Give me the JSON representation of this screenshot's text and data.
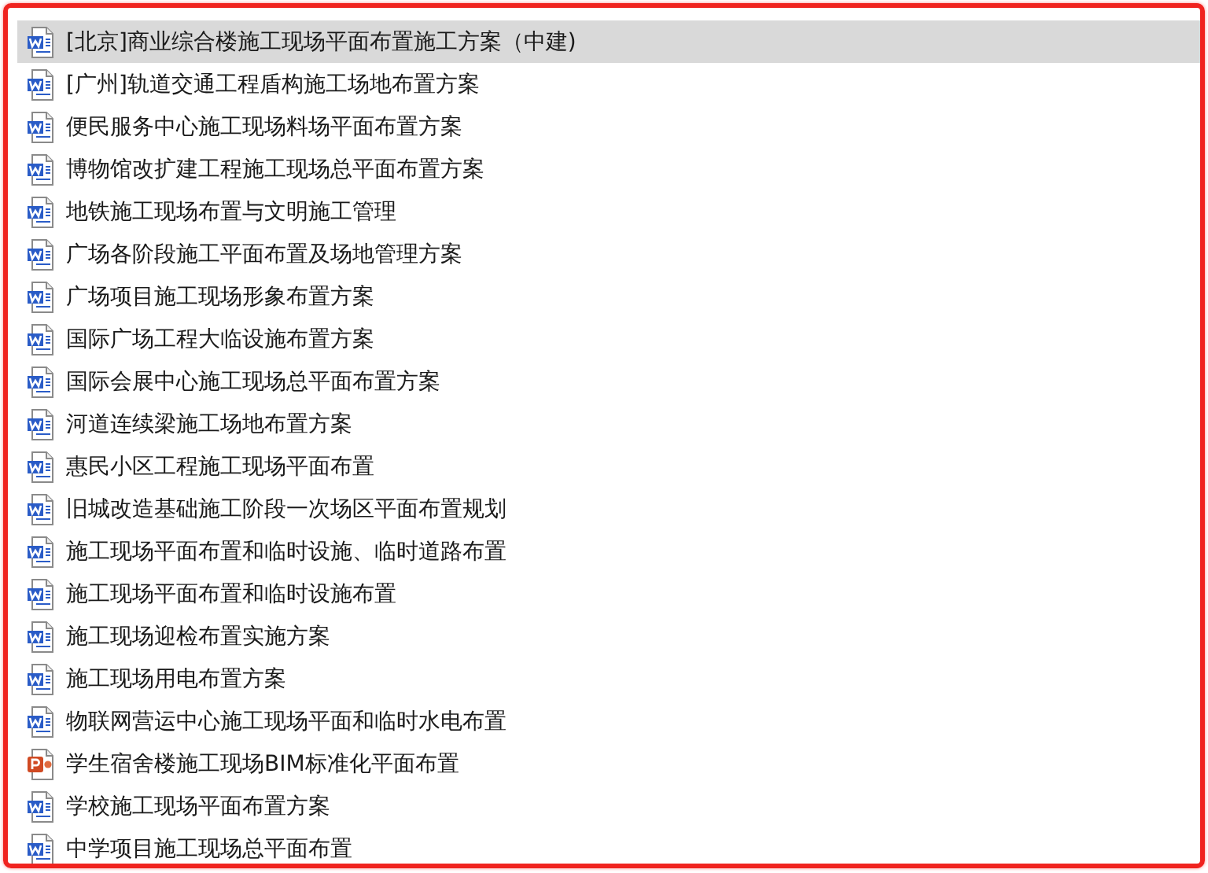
{
  "files": [
    {
      "name": "[北京]商业综合楼施工现场平面布置施工方案（中建)",
      "kind": "word",
      "selected": true
    },
    {
      "name": "[广州]轨道交通工程盾构施工场地布置方案",
      "kind": "word",
      "selected": false
    },
    {
      "name": "便民服务中心施工现场料场平面布置方案",
      "kind": "word",
      "selected": false
    },
    {
      "name": "博物馆改扩建工程施工现场总平面布置方案",
      "kind": "word",
      "selected": false
    },
    {
      "name": "地铁施工现场布置与文明施工管理",
      "kind": "word",
      "selected": false
    },
    {
      "name": "广场各阶段施工平面布置及场地管理方案",
      "kind": "word",
      "selected": false
    },
    {
      "name": "广场项目施工现场形象布置方案",
      "kind": "word",
      "selected": false
    },
    {
      "name": "国际广场工程大临设施布置方案",
      "kind": "word",
      "selected": false
    },
    {
      "name": "国际会展中心施工现场总平面布置方案",
      "kind": "word",
      "selected": false
    },
    {
      "name": "河道连续梁施工场地布置方案",
      "kind": "word",
      "selected": false
    },
    {
      "name": "惠民小区工程施工现场平面布置",
      "kind": "word",
      "selected": false
    },
    {
      "name": "旧城改造基础施工阶段一次场区平面布置规划",
      "kind": "word",
      "selected": false
    },
    {
      "name": "施工现场平面布置和临时设施、临时道路布置",
      "kind": "word",
      "selected": false
    },
    {
      "name": "施工现场平面布置和临时设施布置",
      "kind": "word",
      "selected": false
    },
    {
      "name": "施工现场迎检布置实施方案",
      "kind": "word",
      "selected": false
    },
    {
      "name": "施工现场用电布置方案",
      "kind": "word",
      "selected": false
    },
    {
      "name": "物联网营运中心施工现场平面和临时水电布置",
      "kind": "word",
      "selected": false
    },
    {
      "name": "学生宿舍楼施工现场BIM标准化平面布置",
      "kind": "ppt",
      "selected": false
    },
    {
      "name": "学校施工现场平面布置方案",
      "kind": "word",
      "selected": false
    },
    {
      "name": "中学项目施工现场总平面布置",
      "kind": "word",
      "selected": false
    }
  ]
}
